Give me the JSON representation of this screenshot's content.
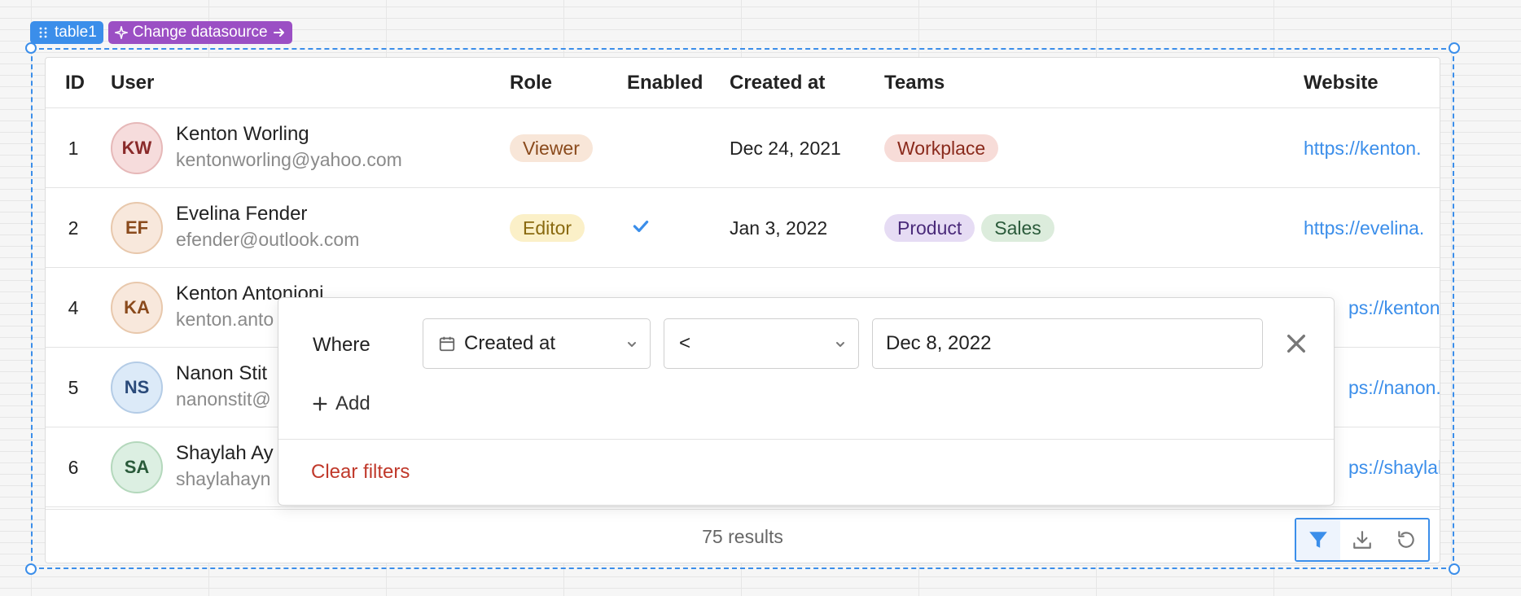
{
  "component_tags": {
    "table_label": "table1",
    "datasource_label": "Change datasource"
  },
  "table": {
    "columns": [
      "ID",
      "User",
      "Role",
      "Enabled",
      "Created at",
      "Teams",
      "Website"
    ],
    "rows": [
      {
        "id": "1",
        "initials": "KW",
        "name": "Kenton Worling",
        "email": "kentonworling@yahoo.com",
        "role": "Viewer",
        "enabled": false,
        "created_at": "Dec 24, 2021",
        "teams": [
          "Workplace"
        ],
        "website": "https://kenton."
      },
      {
        "id": "2",
        "initials": "EF",
        "name": "Evelina Fender",
        "email": "efender@outlook.com",
        "role": "Editor",
        "enabled": true,
        "created_at": "Jan 3, 2022",
        "teams": [
          "Product",
          "Sales"
        ],
        "website": "https://evelina."
      },
      {
        "id": "4",
        "initials": "KA",
        "name": "Kenton Antonioni",
        "email": "kenton.anto",
        "website": "ps://kenton."
      },
      {
        "id": "5",
        "initials": "NS",
        "name": "Nanon Stit",
        "email": "nanonstit@",
        "website": "ps://nanon.s"
      },
      {
        "id": "6",
        "initials": "SA",
        "name": "Shaylah Ay",
        "email": "shaylahayn",
        "website": "ps://shaylah"
      }
    ],
    "results_label": "75 results"
  },
  "filter": {
    "where_label": "Where",
    "column": "Created at",
    "operator": "<",
    "value": "Dec 8, 2022",
    "add_label": "Add",
    "clear_label": "Clear filters"
  },
  "colors": {
    "accent_blue": "#3b8eea",
    "datasource_purple": "#9b4fc4",
    "clear_red": "#c0392b",
    "role_viewer_bg": "#f8e6d8",
    "role_viewer_fg": "#8a4a1c",
    "role_editor_bg": "#fbf0c8",
    "role_editor_fg": "#8a6a10",
    "team_workplace_bg": "#f7dcd8",
    "team_workplace_fg": "#8a2a1c",
    "team_product_bg": "#e6dcf4",
    "team_product_fg": "#4a2a7a",
    "team_sales_bg": "#dcecdc",
    "team_sales_fg": "#2a5a3a"
  },
  "avatar_colors": {
    "KW": {
      "bg": "#f6dcdc",
      "border": "#e6b8b8",
      "fg": "#8a2a2a"
    },
    "EF": {
      "bg": "#f8e8dc",
      "border": "#e8c8ac",
      "fg": "#8a4a1c"
    },
    "KA": {
      "bg": "#f8e8dc",
      "border": "#e8c8ac",
      "fg": "#8a4a1c"
    },
    "NS": {
      "bg": "#dceaf8",
      "border": "#b4cce6",
      "fg": "#2a4a7a"
    },
    "SA": {
      "bg": "#dcefe2",
      "border": "#b4d8bc",
      "fg": "#2a5a3a"
    }
  },
  "icons": {
    "drag": "grip-dots-icon",
    "sparkle": "sparkle-icon",
    "arrow": "arrow-right-icon",
    "calendar": "calendar-icon",
    "chevron": "chevron-down-icon",
    "close": "close-icon",
    "plus": "plus-icon",
    "filter": "filter-icon",
    "download": "download-icon",
    "refresh": "refresh-icon",
    "check": "checkmark-icon"
  }
}
